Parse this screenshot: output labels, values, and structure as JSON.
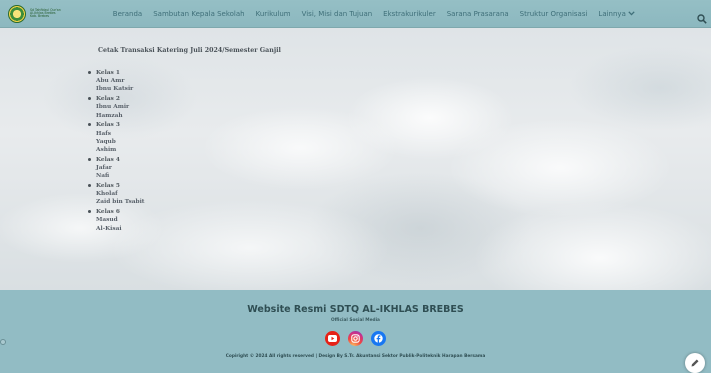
{
  "header": {
    "logo_lines": [
      "Sd Tahfidzul Qur'an",
      "Al-Ikhlas Brebes",
      "Kab. Brebes"
    ],
    "nav": [
      {
        "label": "Beranda"
      },
      {
        "label": "Sambutan Kepala Sekolah"
      },
      {
        "label": "Kurikulum"
      },
      {
        "label": "Visi, Misi dan Tujuan"
      },
      {
        "label": "Ekstrakurikuler"
      },
      {
        "label": "Sarana Prasarana"
      },
      {
        "label": "Struktur Organisasi"
      },
      {
        "label": "Lainnya"
      }
    ],
    "colors": {
      "bar": "#8cb8bf",
      "text": "#3f6f79"
    }
  },
  "main": {
    "title": "Cetak Transaksi Katering Juli 2024/Semester Ganjil",
    "classes": [
      {
        "name": "Kelas 1",
        "students": [
          "Abu Amr",
          "Ibnu Katsir"
        ]
      },
      {
        "name": "Kelas 2",
        "students": [
          "Ibnu Amir",
          "Hamzah"
        ]
      },
      {
        "name": "Kelas 3",
        "students": [
          "Hafs",
          "Yaqub",
          "Ashim"
        ]
      },
      {
        "name": "Kelas 4",
        "students": [
          "Jafar",
          "Nafi"
        ]
      },
      {
        "name": "Kelas 5",
        "students": [
          "Kholaf",
          "Zaid bin Tsabit"
        ]
      },
      {
        "name": "Kelas 6",
        "students": [
          "Masud",
          "Al-Kisai"
        ]
      }
    ]
  },
  "footer": {
    "title": "Website Resmi SDTQ AL-IKHLAS BREBES",
    "subtitle": "Official Sosial Media",
    "socials": [
      {
        "icon": "youtube-icon",
        "color": "#e62117"
      },
      {
        "icon": "instagram-icon",
        "color": "#cd2f8a"
      },
      {
        "icon": "facebook-icon",
        "color": "#1877f2"
      }
    ],
    "copyright": "Copiright © 2024 All rights reserved | Design By S.Tr. Akuntansi Sektor Publik-Politeknik Harapan Bersama",
    "colors": {
      "background": "#92bcc4"
    }
  }
}
